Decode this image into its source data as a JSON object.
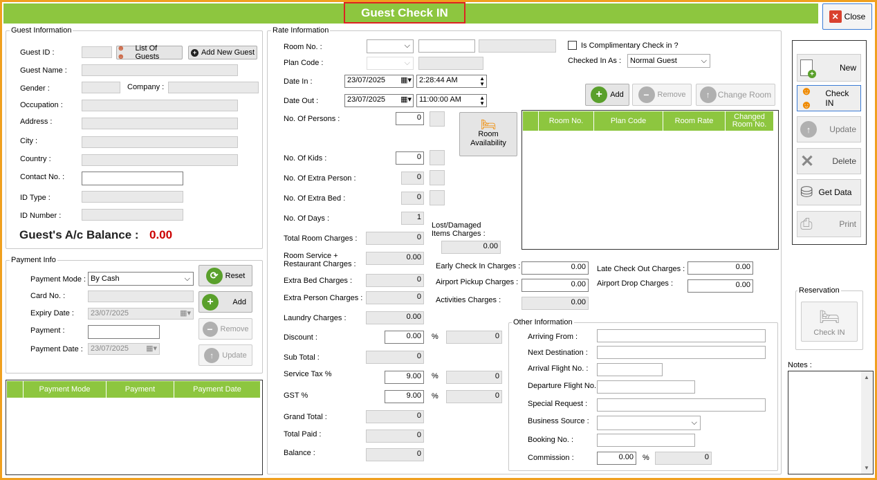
{
  "title": "Guest Check IN",
  "close_label": "Close",
  "guest": {
    "group": "Guest Information",
    "id_label": "Guest ID :",
    "list_btn": "List Of Guests",
    "add_btn": "Add New Guest",
    "name_label": "Guest Name :",
    "gender_label": "Gender :",
    "company_label": "Company :",
    "occupation_label": "Occupation :",
    "address_label": "Address :",
    "city_label": "City :",
    "country_label": "Country :",
    "contact_label": "Contact No. :",
    "idtype_label": "ID Type :",
    "idnum_label": "ID Number :",
    "balance_label": "Guest's A/c Balance :",
    "balance_value": "0.00"
  },
  "payment": {
    "group": "Payment Info",
    "mode_label": "Payment Mode :",
    "mode_value": "By Cash",
    "card_label": "Card No. :",
    "expiry_label": "Expiry Date :",
    "expiry_value": "23/07/2025",
    "payment_label": "Payment :",
    "date_label": "Payment Date :",
    "date_value": "23/07/2025",
    "reset": "Reset",
    "add": "Add",
    "remove": "Remove",
    "update": "Update",
    "columns": [
      "Payment Mode",
      "Payment",
      "Payment Date"
    ]
  },
  "rate": {
    "group": "Rate Information",
    "room_label": "Room No. :",
    "plan_label": "Plan Code :",
    "datein_label": "Date In :",
    "datein": "23/07/2025",
    "timein": "2:28:44 AM",
    "dateout_label": "Date Out :",
    "dateout": "23/07/2025",
    "timeout": "11:00:00 AM",
    "comp_label": "Is Complimentary Check in ?",
    "checkedas_label": "Checked In As :",
    "checkedas_value": "Normal Guest",
    "add": "Add",
    "remove": "Remove",
    "change": "Change Room",
    "avail": "Room Availability",
    "columns": [
      "Room No.",
      "Plan Code",
      "Room Rate",
      "Changed Room No."
    ],
    "persons_label": "No. Of Persons :",
    "persons": "0",
    "kids_label": "No. Of Kids :",
    "kids": "0",
    "extra_person_label": "No. Of Extra Person :",
    "extra_person": "0",
    "extra_bed_label": "No. Of Extra Bed :",
    "extra_bed": "0",
    "days_label": "No. Of Days :",
    "days": "1",
    "total_room_label": "Total Room Charges :",
    "total_room": "0",
    "lost_label": "Lost/Damaged Items Charges :",
    "lost": "0.00",
    "room_service_label": "Room Service + Restaurant Charges :",
    "room_service": "0.00",
    "extra_bed_ch_label": "Extra Bed Charges :",
    "extra_bed_ch": "0",
    "extra_person_ch_label": "Extra Person Charges :",
    "extra_person_ch": "0",
    "laundry_label": "Laundry Charges :",
    "laundry": "0.00",
    "discount_label": "Discount :",
    "discount": "0.00",
    "discount_amt": "0",
    "subtotal_label": "Sub Total :",
    "subtotal": "0",
    "service_tax_label": "Service Tax %",
    "service_tax": "9.00",
    "service_tax_amt": "0",
    "gst_label": "GST %",
    "gst": "9.00",
    "gst_amt": "0",
    "grand_label": "Grand Total :",
    "grand": "0",
    "paid_label": "Total Paid :",
    "paid": "0",
    "balance_label": "Balance :",
    "balance": "0",
    "pct": "%",
    "early_label": "Early Check In Charges :",
    "early": "0.00",
    "late_label": "Late Check Out Charges :",
    "late": "0.00",
    "pickup_label": "Airport Pickup Charges :",
    "pickup": "0.00",
    "drop_label": "Airport Drop Charges :",
    "drop": "0.00",
    "activities_label": "Activities Charges :",
    "activities": "0.00"
  },
  "other": {
    "group": "Other Information",
    "arriving_label": "Arriving From :",
    "next_label": "Next Destination :",
    "arr_flight_label": "Arrival Flight No. :",
    "dep_flight_label": "Departure Flight No. :",
    "special_label": "Special Request :",
    "business_label": "Business Source :",
    "booking_label": "Booking No. :",
    "commission_label": "Commission :",
    "commission": "0.00",
    "commission_amt": "0"
  },
  "sidebar": {
    "new": "New",
    "checkin": "Check IN",
    "update": "Update",
    "delete": "Delete",
    "getdata": "Get Data",
    "print": "Print",
    "reservation": "Reservation",
    "res_checkin": "Check IN",
    "notes": "Notes :"
  }
}
